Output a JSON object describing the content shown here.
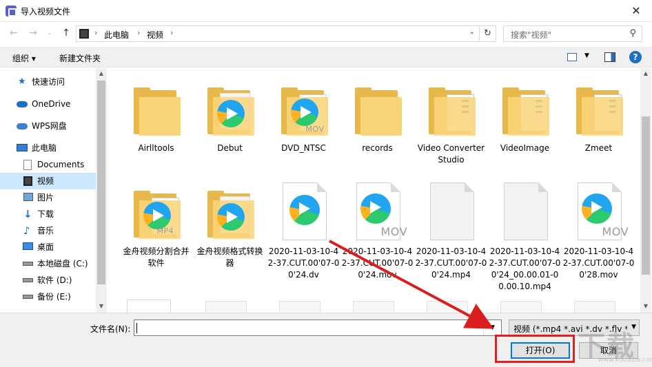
{
  "window": {
    "title": "导入视频文件",
    "close_glyph": "✕"
  },
  "address_bar": {
    "crumbs": [
      "此电脑",
      "视频"
    ],
    "search_placeholder": "搜索\"视频\""
  },
  "toolbar": {
    "organize_label": "组织 ▾",
    "new_folder_label": "新建文件夹"
  },
  "sidebar": {
    "items": [
      {
        "label": "快速访问",
        "icon": "star-icon"
      },
      {
        "label": "OneDrive",
        "icon": "cloud-icon"
      },
      {
        "label": "WPS网盘",
        "icon": "cloud-icon"
      },
      {
        "label": "此电脑",
        "icon": "computer-icon"
      },
      {
        "label": "Documents",
        "icon": "document-icon"
      },
      {
        "label": "视频",
        "icon": "film-icon",
        "active": true
      },
      {
        "label": "图片",
        "icon": "picture-icon"
      },
      {
        "label": "下载",
        "icon": "download-icon"
      },
      {
        "label": "音乐",
        "icon": "music-icon"
      },
      {
        "label": "桌面",
        "icon": "desktop-icon"
      },
      {
        "label": "本地磁盘 (C:)",
        "icon": "drive-icon"
      },
      {
        "label": "软件 (D:)",
        "icon": "drive-icon"
      },
      {
        "label": "备份 (E:)",
        "icon": "drive-icon"
      }
    ]
  },
  "files": [
    {
      "name": "Airlltools",
      "type": "folder"
    },
    {
      "name": "Debut",
      "type": "folder-video"
    },
    {
      "name": "DVD_NTSC",
      "type": "folder-mov",
      "tag": "MOV"
    },
    {
      "name": "records",
      "type": "folder"
    },
    {
      "name": "Video Converter Studio",
      "type": "folder-doc"
    },
    {
      "name": "VideoImage",
      "type": "folder-doc"
    },
    {
      "name": "Zmeet",
      "type": "folder-doc"
    },
    {
      "name": "金舟视频分割合并软件",
      "type": "folder-mp4",
      "tag": "MP4"
    },
    {
      "name": "金舟视频格式转换器",
      "type": "folder-video"
    },
    {
      "name": "2020-11-03-10-42-37.CUT.00'07-00'24.dv",
      "type": "video"
    },
    {
      "name": "2020-11-03-10-42-37.CUT.00'07-00'24.mov",
      "type": "video-mov",
      "tag": "MOV"
    },
    {
      "name": "2020-11-03-10-42-37.CUT.00'07-00'24.mp4",
      "type": "blank"
    },
    {
      "name": "2020-11-03-10-42-37.CUT.00'07-00'24_00.00.01-00.00.10.mp4",
      "type": "blank"
    },
    {
      "name": "2020-11-03-10-42-37.CUT.00'07-00'28.mov",
      "type": "video-mov",
      "tag": "MOV"
    }
  ],
  "bottom": {
    "filename_label": "文件名(N):",
    "filename_value": "",
    "filetype_value": "视频 (*.mp4 *.avi *.dv *.flv *.m",
    "open_label": "打开(O)",
    "cancel_label": "取消"
  },
  "watermark": {
    "big": "下载",
    "small": "www.xiazaiba.com"
  },
  "colors": {
    "accent": "#0078d7",
    "annotation_red": "#e02020",
    "folder": "#f9d57a"
  }
}
